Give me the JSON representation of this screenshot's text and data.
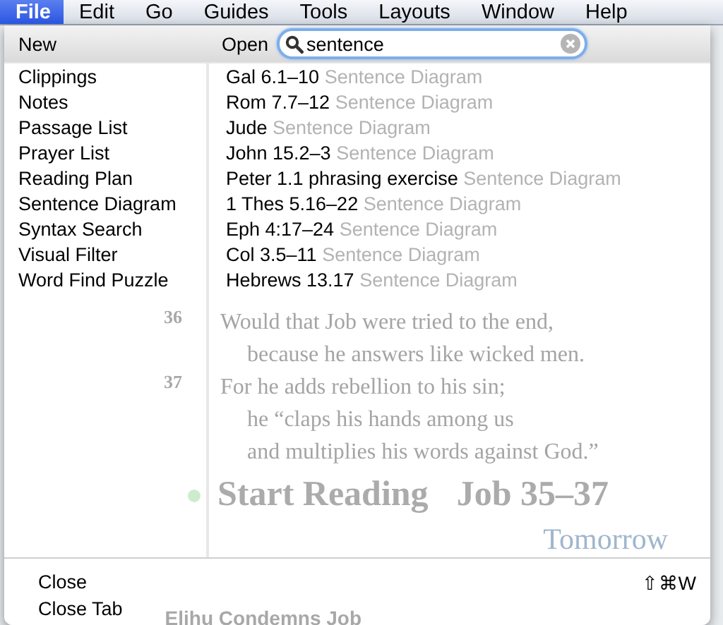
{
  "menu_bar": {
    "items": [
      {
        "label": "File",
        "selected": true
      },
      {
        "label": "Edit",
        "selected": false
      },
      {
        "label": "Go",
        "selected": false
      },
      {
        "label": "Guides",
        "selected": false
      },
      {
        "label": "Tools",
        "selected": false
      },
      {
        "label": "Layouts",
        "selected": false
      },
      {
        "label": "Window",
        "selected": false
      },
      {
        "label": "Help",
        "selected": false
      }
    ]
  },
  "menu": {
    "new": {
      "heading": "New",
      "items": [
        "Clippings",
        "Notes",
        "Passage List",
        "Prayer List",
        "Reading Plan",
        "Sentence Diagram",
        "Syntax Search",
        "Visual Filter",
        "Word Find Puzzle"
      ]
    },
    "open": {
      "heading": "Open",
      "search": {
        "value": "sentence"
      },
      "items": [
        {
          "title": "Gal 6.1–10",
          "type": "Sentence Diagram"
        },
        {
          "title": "Rom 7.7–12",
          "type": "Sentence Diagram"
        },
        {
          "title": "Jude",
          "type": "Sentence Diagram"
        },
        {
          "title": "John 15.2–3",
          "type": "Sentence Diagram"
        },
        {
          "title": "Peter 1.1 phrasing exercise",
          "type": "Sentence Diagram"
        },
        {
          "title": "1 Thes 5.16–22",
          "type": "Sentence Diagram"
        },
        {
          "title": "Eph 4:17–24",
          "type": "Sentence Diagram"
        },
        {
          "title": "Col 3.5–11",
          "type": "Sentence Diagram"
        },
        {
          "title": "Hebrews 13.17",
          "type": "Sentence Diagram"
        }
      ]
    },
    "footer": [
      {
        "label": "Close",
        "shortcut": "⇧⌘W"
      },
      {
        "label": "Close Tab"
      }
    ]
  },
  "background": {
    "verses": [
      {
        "number": "36",
        "lines": [
          {
            "text": "Would that Job were tried to the end,",
            "indented": false
          },
          {
            "text": "because he answers like wicked men.",
            "indented": true
          }
        ]
      },
      {
        "number": "37",
        "lines": [
          {
            "text": "For he adds rebellion to his sin;",
            "indented": false
          },
          {
            "text": "he “claps his hands among us",
            "indented": true
          },
          {
            "text": "and multiplies his words against God.”",
            "indented": true
          }
        ]
      }
    ],
    "start_reading": {
      "label": "Start Reading",
      "passage": "Job 35–37"
    },
    "next_link": "Tomorrow",
    "section_heading": "Elihu Condemns Job"
  }
}
